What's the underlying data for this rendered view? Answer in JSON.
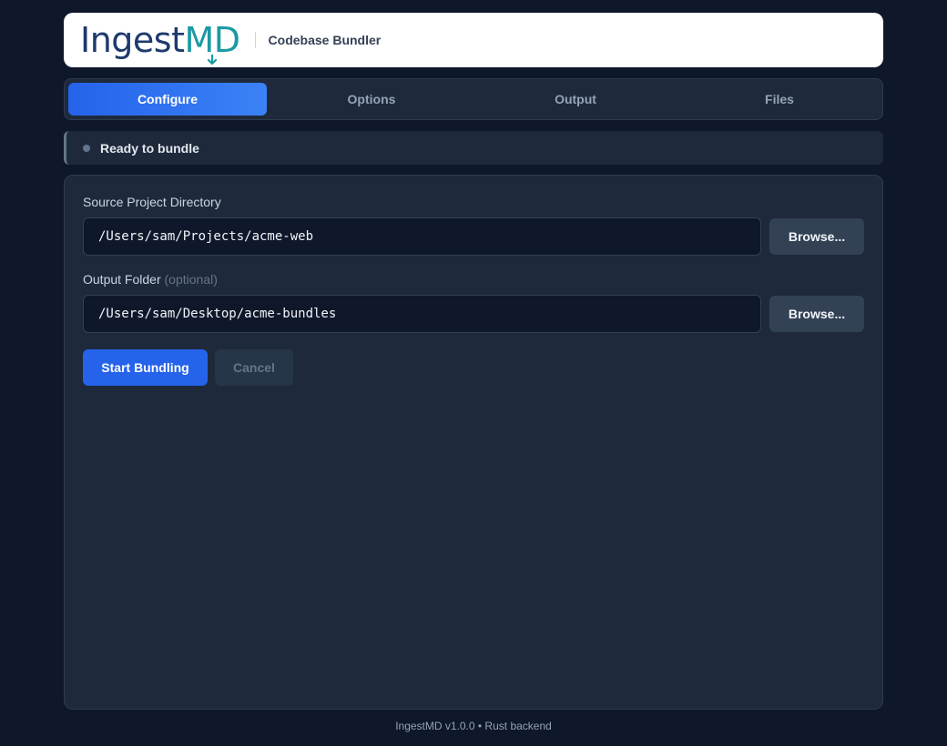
{
  "header": {
    "logo_primary": "Ingest",
    "logo_accent": "MD",
    "subtitle": "Codebase Bundler"
  },
  "tabs": [
    {
      "label": "Configure",
      "active": true
    },
    {
      "label": "Options",
      "active": false
    },
    {
      "label": "Output",
      "active": false
    },
    {
      "label": "Files",
      "active": false
    }
  ],
  "status": {
    "text": "Ready to bundle",
    "color": "#64748b"
  },
  "form": {
    "source": {
      "label": "Source Project Directory",
      "value": "/Users/sam/Projects/acme-web",
      "browse_label": "Browse..."
    },
    "output": {
      "label": "Output Folder",
      "optional_label": "(optional)",
      "value": "/Users/sam/Desktop/acme-bundles",
      "browse_label": "Browse..."
    },
    "start_label": "Start Bundling",
    "cancel_label": "Cancel"
  },
  "footer": {
    "text": "IngestMD v1.0.0 • Rust backend"
  },
  "colors": {
    "background": "#0f172a",
    "panel": "#1e293b",
    "accent": "#2563eb",
    "logo_navy": "#1e3a6d",
    "logo_teal": "#1a9aa3"
  },
  "icons": {
    "logo_mark": "download-arrow-icon",
    "status": "status-dot-icon"
  }
}
